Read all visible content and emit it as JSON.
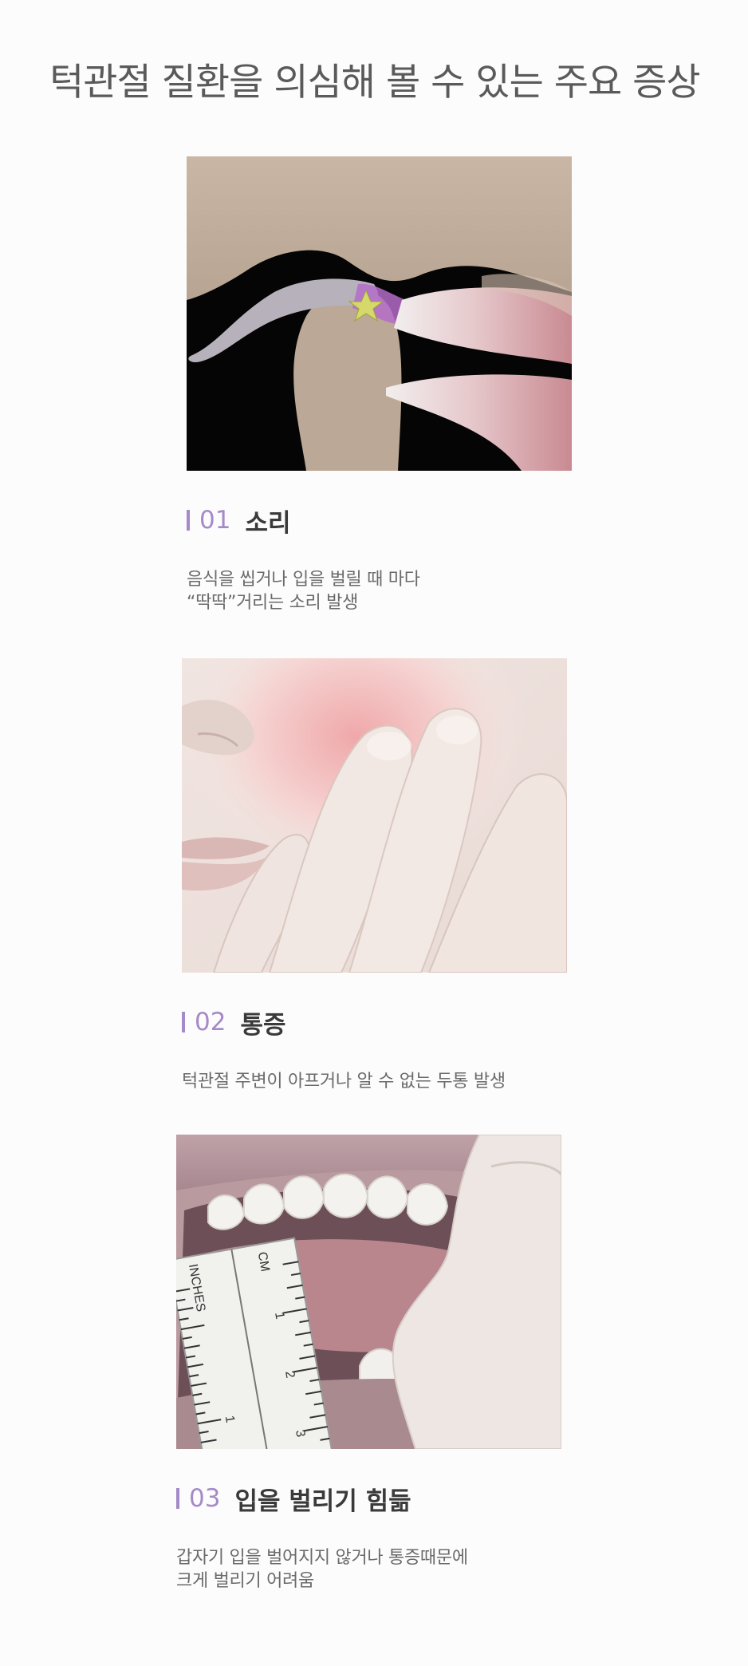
{
  "page": {
    "title": "턱관절 질환을 의심해 볼 수 있는 주요 증상"
  },
  "accent_color": "#a58ac8",
  "symptoms": [
    {
      "number": "01",
      "label": "소리",
      "desc_line1": "음식을 씹거나 입을 벌릴 때 마다",
      "desc_line2": "“딱딱”거리는 소리 발생"
    },
    {
      "number": "02",
      "label": "통증",
      "desc_line1": "턱관절 주변이 아프거나 알 수 없는 두통 발생"
    },
    {
      "number": "03",
      "label": "입을 벌리기 힘듦",
      "desc_line1": "갑자기 입을 벌어지지 않거나 통증때문에",
      "desc_line2": "크게 벌리기 어려움"
    }
  ],
  "ruler": {
    "unit_inches": "INCHES",
    "unit_cm": "CM",
    "marks": [
      "1",
      "2",
      "3",
      "1"
    ]
  }
}
